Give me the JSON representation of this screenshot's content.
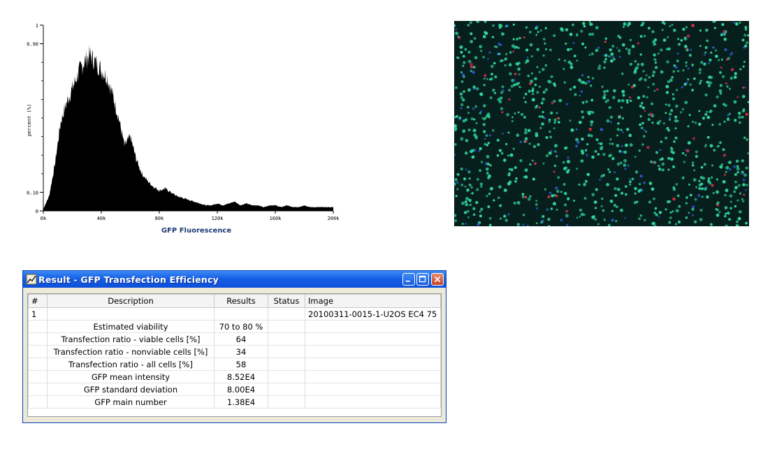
{
  "chart_data": {
    "type": "area",
    "title": "",
    "xlabel": "GFP Fluorescence",
    "ylabel": "percent (%)",
    "x_ticks": [
      "0k",
      "40k",
      "80k",
      "120k",
      "160k",
      "200k"
    ],
    "y_ticks": [
      "0",
      "0.10",
      "0.90",
      "1"
    ],
    "xlim": [
      0,
      200000
    ],
    "ylim": [
      0,
      1
    ],
    "x": [
      0,
      4000,
      8000,
      12000,
      16000,
      20000,
      24000,
      28000,
      32000,
      36000,
      40000,
      44000,
      48000,
      52000,
      56000,
      60000,
      64000,
      68000,
      72000,
      76000,
      80000,
      84000,
      88000,
      92000,
      96000,
      100000,
      104000,
      108000,
      112000,
      116000,
      120000,
      124000,
      128000,
      132000,
      136000,
      140000,
      144000,
      148000,
      152000,
      156000,
      160000,
      164000,
      168000,
      172000,
      176000,
      180000,
      184000,
      188000,
      192000,
      196000,
      200000
    ],
    "values": [
      0.01,
      0.08,
      0.25,
      0.48,
      0.58,
      0.66,
      0.74,
      0.8,
      0.84,
      0.8,
      0.76,
      0.72,
      0.62,
      0.5,
      0.35,
      0.4,
      0.28,
      0.2,
      0.16,
      0.13,
      0.11,
      0.12,
      0.1,
      0.08,
      0.07,
      0.06,
      0.05,
      0.04,
      0.03,
      0.03,
      0.04,
      0.03,
      0.04,
      0.05,
      0.03,
      0.04,
      0.03,
      0.03,
      0.02,
      0.03,
      0.03,
      0.02,
      0.03,
      0.02,
      0.02,
      0.03,
      0.02,
      0.02,
      0.02,
      0.02,
      0.02
    ],
    "fill_color": "#000000"
  },
  "window": {
    "title": "Result - GFP Transfection Efficiency",
    "columns": [
      "#",
      "Description",
      "Results",
      "Status",
      "Image"
    ],
    "rows": [
      {
        "num": "1",
        "description": "",
        "result": "",
        "status": "",
        "image": "20100311-0015-1-U2OS EC4 75"
      },
      {
        "num": "",
        "description": "Estimated viability",
        "result": "70 to 80 %",
        "status": "",
        "image": ""
      },
      {
        "num": "",
        "description": "Transfection ratio - viable cells [%]",
        "result": "64",
        "status": "",
        "image": ""
      },
      {
        "num": "",
        "description": "Transfection ratio - nonviable cells [%]",
        "result": "34",
        "status": "",
        "image": ""
      },
      {
        "num": "",
        "description": "Transfection ratio - all cells [%]",
        "result": "58",
        "status": "",
        "image": ""
      },
      {
        "num": "",
        "description": "GFP mean intensity",
        "result": "8.52E4",
        "status": "",
        "image": ""
      },
      {
        "num": "",
        "description": "GFP standard deviation",
        "result": "8.00E4",
        "status": "",
        "image": ""
      },
      {
        "num": "",
        "description": "GFP main number",
        "result": "1.38E4",
        "status": "",
        "image": ""
      }
    ],
    "icons": {
      "title_icon": "chart-icon",
      "minimize": "minimize-icon",
      "maximize": "maximize-icon",
      "close": "close-icon"
    },
    "colors": {
      "titlebar": "#1660e6",
      "close_button": "#c9431f"
    }
  },
  "micrograph": {
    "icon": "fluorescence-micrograph",
    "colors": {
      "background": "#071f1c",
      "gfp": "#33d9a0",
      "nucleus": "#2c5bd6",
      "dead": "#e0304a"
    }
  }
}
